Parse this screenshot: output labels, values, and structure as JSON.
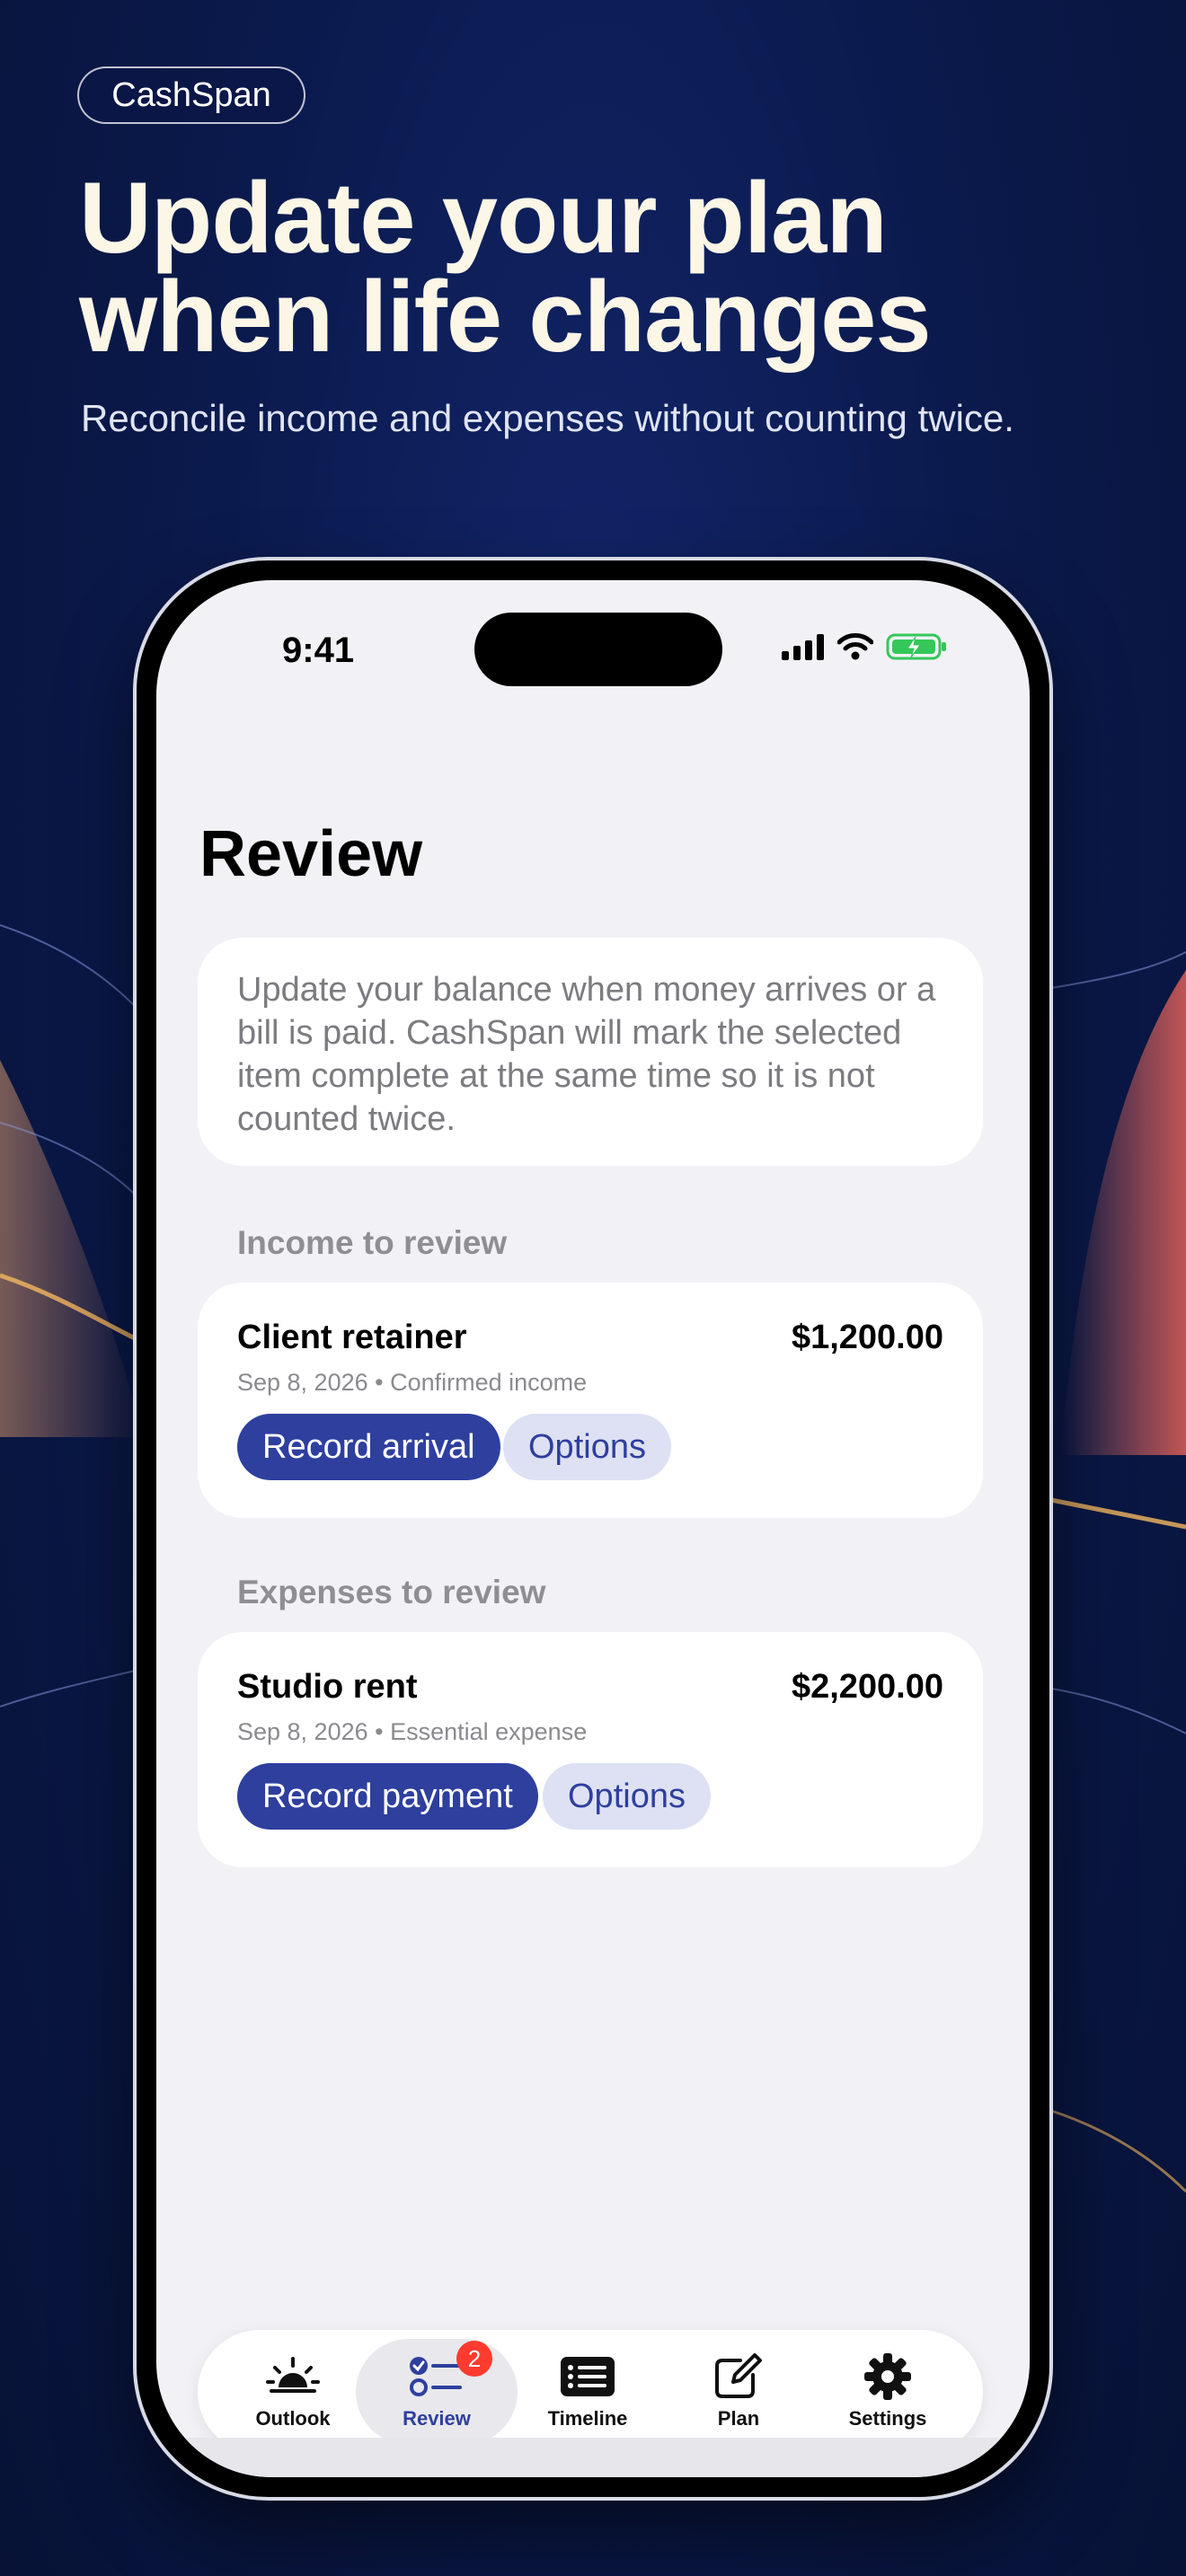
{
  "brand": "CashSpan",
  "headline": [
    "Update your plan",
    "when life changes"
  ],
  "subhead": "Reconcile income and expenses without counting twice.",
  "status": {
    "time": "9:41"
  },
  "screen": {
    "title": "Review",
    "info": "Update your balance when money arrives or a bill is paid. CashSpan will mark the selected item complete at the same time so it is not counted twice.",
    "income": {
      "section_label": "Income to review",
      "item": {
        "name": "Client retainer",
        "amount": "$1,200.00",
        "meta": "Sep 8, 2026 • Confirmed income",
        "primary_label": "Record arrival",
        "secondary_label": "Options"
      }
    },
    "expenses": {
      "section_label": "Expenses to review",
      "item": {
        "name": "Studio rent",
        "amount": "$2,200.00",
        "meta": "Sep 8, 2026 • Essential expense",
        "primary_label": "Record payment",
        "secondary_label": "Options"
      }
    }
  },
  "tabs": [
    {
      "label": "Outlook",
      "icon": "sunrise-icon"
    },
    {
      "label": "Review",
      "icon": "checklist-icon",
      "badge": "2",
      "active": true
    },
    {
      "label": "Timeline",
      "icon": "list-icon"
    },
    {
      "label": "Plan",
      "icon": "edit-icon"
    },
    {
      "label": "Settings",
      "icon": "gear-icon"
    }
  ],
  "colors": {
    "accent": "#2e3f9e",
    "accent_light": "#dde1f3",
    "badge": "#ff3b30",
    "background": "#0b1a4d",
    "screen_bg": "#f2f2f6"
  }
}
